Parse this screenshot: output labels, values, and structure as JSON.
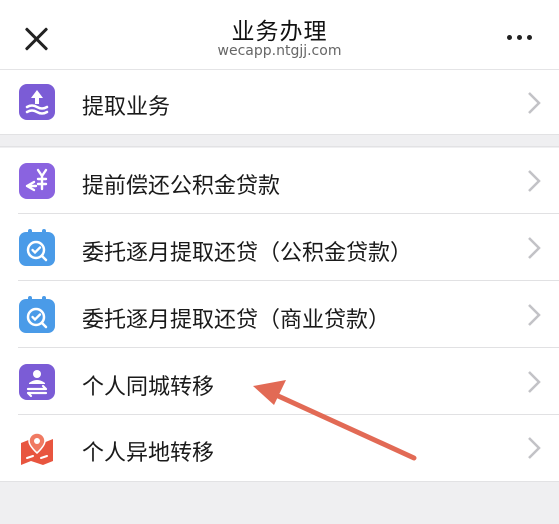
{
  "header": {
    "title": "业务办理",
    "subtitle": "wecapp.ntgjj.com",
    "close_icon": "close-icon",
    "more_icon": "more-dots-icon"
  },
  "sections": [
    {
      "items": [
        {
          "label": "提取业务",
          "icon": "withdraw-icon",
          "icon_color": "#7b5cd6"
        }
      ]
    },
    {
      "items": [
        {
          "label": "提前偿还公积金贷款",
          "icon": "yuan-return-icon",
          "icon_color": "#8a63e0"
        },
        {
          "label": "委托逐月提取还贷（公积金贷款）",
          "icon": "calendar-check-icon",
          "icon_color": "#4a9be8"
        },
        {
          "label": "委托逐月提取还贷（商业贷款）",
          "icon": "calendar-check-icon",
          "icon_color": "#4a9be8"
        },
        {
          "label": "个人同城转移",
          "icon": "person-transfer-icon",
          "icon_color": "#7b5cd6"
        },
        {
          "label": "个人异地转移",
          "icon": "location-transfer-icon",
          "icon_color": "#e8553f"
        }
      ]
    }
  ],
  "annotation": {
    "type": "arrow",
    "color": "#e26a55",
    "points_to": "个人同城转移"
  }
}
